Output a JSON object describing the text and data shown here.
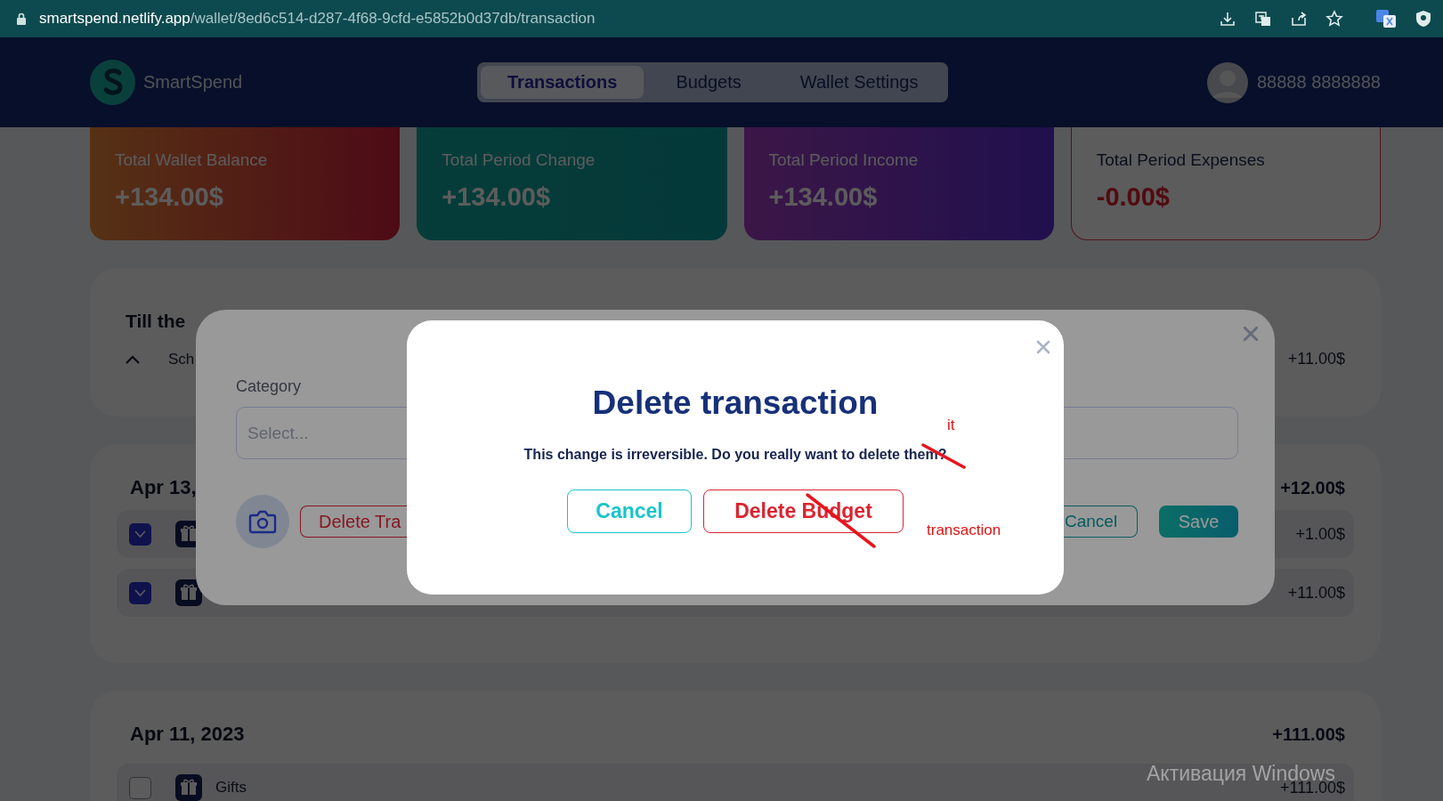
{
  "browser": {
    "url_domain": "smartspend.netlify.app",
    "url_path": "/wallet/8ed6c514-d287-4f68-9cfd-e5852b0d37db/transaction"
  },
  "header": {
    "brand": "SmartSpend",
    "user": "88888 8888888",
    "tabs": [
      {
        "label": "Transactions",
        "selected": true
      },
      {
        "label": "Budgets",
        "selected": false
      },
      {
        "label": "Wallet Settings",
        "selected": false
      }
    ]
  },
  "stats": [
    {
      "kind": "balance",
      "label": "Total Wallet Balance",
      "value": "+134.00$"
    },
    {
      "kind": "change",
      "label": "Total Period Change",
      "value": "+134.00$"
    },
    {
      "kind": "income",
      "label": "Total Period Income",
      "value": "+134.00$"
    },
    {
      "kind": "expenses",
      "label": "Total Period Expenses",
      "value": "-0.00$"
    }
  ],
  "groups": [
    {
      "title": "Till the",
      "rows": [
        {
          "kind": "scheduled",
          "expanded": true,
          "name": "Sch",
          "amount": "+11.00$"
        }
      ]
    },
    {
      "title": "Apr 13,",
      "total": "+12.00$",
      "rows": [
        {
          "kind": "transaction",
          "checked": true,
          "amount": "+1.00$"
        },
        {
          "kind": "transaction",
          "checked": true,
          "amount": "+11.00$"
        }
      ]
    },
    {
      "title": "Apr 11, 2023",
      "total": "+111.00$",
      "rows": [
        {
          "kind": "transaction",
          "checked": false,
          "name": "Gifts",
          "amount": "+111.00$"
        }
      ]
    }
  ],
  "edit_modal": {
    "category_label": "Category",
    "category_placeholder": "Select...",
    "delete_button": "Delete Tra",
    "cancel_button": "Cancel",
    "save_button": "Save"
  },
  "confirm_dialog": {
    "title": "Delete transaction",
    "message": "This change is irreversible. Do you really want to delete them?",
    "cancel_button": "Cancel",
    "confirm_button": "Delete Budget",
    "annotations": [
      "it",
      "transaction"
    ]
  },
  "os_notice": {
    "text": "Активация Windows"
  }
}
